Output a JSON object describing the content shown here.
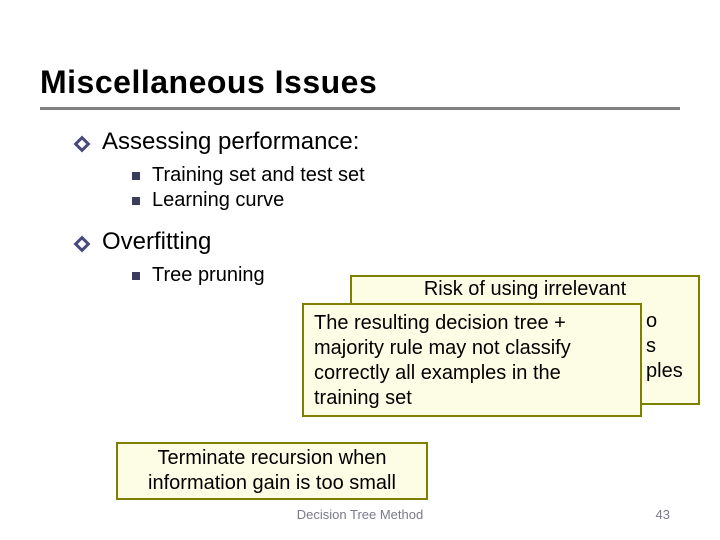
{
  "title": "Miscellaneous Issues",
  "bullets": {
    "l1a": "Assessing performance:",
    "l2a": "Training set and test set",
    "l2b": "Learning curve",
    "l1b": "Overfitting",
    "l2c": "Tree pruning"
  },
  "callouts": {
    "risk_top": "Risk of using irrelevant",
    "back_right_1": "o",
    "back_right_2": "s",
    "back_right_3": "ples",
    "result": "The resulting decision tree + majority rule may not classify correctly all examples in the training set",
    "terminate": "Terminate recursion when information gain is too small"
  },
  "footer": {
    "center": "Decision Tree Method",
    "page": "43"
  }
}
